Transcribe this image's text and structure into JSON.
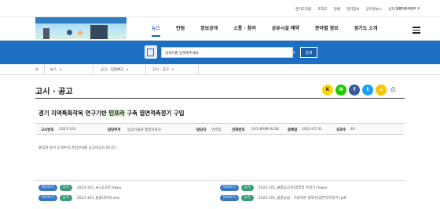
{
  "toplinks": [
    "경기도지원",
    "조직도",
    "담배",
    "대기정보",
    "공무원뉴스",
    "글자크기 −"
  ],
  "language": "Language",
  "nav": [
    {
      "label": "뉴스",
      "active": true
    },
    {
      "label": "민원",
      "active": false
    },
    {
      "label": "정보공개",
      "active": false
    },
    {
      "label": "소통 · 참여",
      "active": false
    },
    {
      "label": "공유시설 예약",
      "active": false
    },
    {
      "label": "분야별 정보",
      "active": false
    },
    {
      "label": "경기도 소개",
      "active": false
    }
  ],
  "search": {
    "placeholder": "검색어를 입력해주세요",
    "button": "검색"
  },
  "breadcrumb": {
    "level1": "뉴스",
    "level2": "공고 · 입법예고",
    "level3": "고시 · 공고"
  },
  "page_title": "고시 · 공고",
  "share": {
    "kakao": "K",
    "naver": "N",
    "facebook": "f",
    "twitter": "t",
    "kakaostory": "s"
  },
  "post": {
    "title_before": "경기 지역특화작목 연구기반 ",
    "title_highlight": "인프라",
    "title_after": " 구축 엽면적측정기 구입",
    "meta": [
      {
        "key": "고시번호",
        "value": "2023-101"
      },
      {
        "key": "담당부서",
        "value": "농업기술원 행정지원과"
      },
      {
        "key": "담당자",
        "value": "연경희"
      },
      {
        "key": "전화번호",
        "value": "031-8008-9238"
      },
      {
        "key": "등록일",
        "value": "2023-07-31"
      },
      {
        "key": "조회수",
        "value": "40"
      }
    ],
    "body": "붙임과 같이 소액수의 견적안내를 공고하고자 합니다."
  },
  "files": [
    {
      "view": "바로보기",
      "download": "듣기",
      "name": "2023-101_★1공고문.hwpx"
    },
    {
      "view": "바로보기",
      "download": "듣기",
      "name": "2023-101_물품공고서(엽면적 측정기).hwpx"
    },
    {
      "view": "바로보기",
      "download": "듣기",
      "name": "2023-101_물품내역서.xlsx"
    },
    {
      "view": "바로보기",
      "download": "듣기",
      "name": "2023-101_물품공급 · 기술지원 협약서(엽면적측정기).pdf"
    }
  ]
}
